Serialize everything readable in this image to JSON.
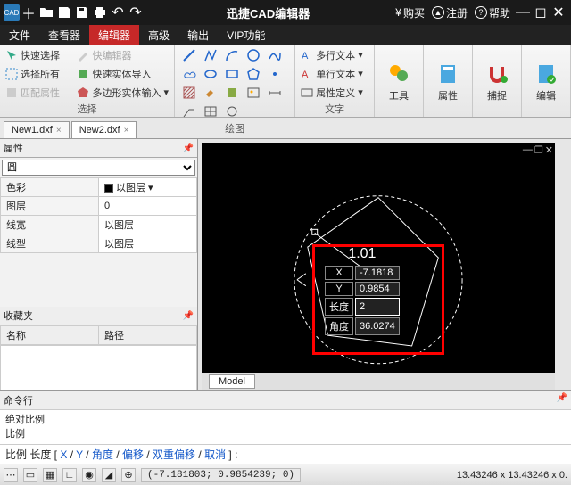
{
  "title": "迅捷CAD编辑器",
  "titlebar_right": {
    "buy": "购买",
    "register": "注册",
    "help": "帮助"
  },
  "menu": [
    "文件",
    "查看器",
    "编辑器",
    "高级",
    "输出",
    "VIP功能"
  ],
  "menu_active": 2,
  "ribbon": {
    "select": {
      "label": "选择",
      "quick": "快速选择",
      "all": "选择所有",
      "match": "匹配属性",
      "qedit": "快编辑器",
      "import": "快速实体导入",
      "poly": "多边形实体输入"
    },
    "draw": {
      "label": "绘图"
    },
    "text": {
      "label": "文字",
      "multi": "多行文本",
      "single": "单行文本",
      "attr": "属性定义"
    },
    "tools": "工具",
    "props": "属性",
    "capture": "捕捉",
    "edit": "编辑"
  },
  "file_tabs": [
    "New1.dxf",
    "New2.dxf"
  ],
  "file_tab_active": 1,
  "props_panel": {
    "title": "属性",
    "object": "圆",
    "rows": [
      {
        "k": "色彩",
        "v": "以图层",
        "swatch": true
      },
      {
        "k": "图层",
        "v": "0"
      },
      {
        "k": "线宽",
        "v": "以图层"
      },
      {
        "k": "线型",
        "v": "以图层"
      }
    ]
  },
  "fav": {
    "title": "收藏夹",
    "cols": [
      "名称",
      "路径"
    ]
  },
  "canvas": {
    "coord_title": "1.01",
    "fields": [
      {
        "k": "X",
        "v": "-7.1818"
      },
      {
        "k": "Y",
        "v": "0.9854"
      },
      {
        "k": "长度",
        "v": "2"
      },
      {
        "k": "角度",
        "v": "36.0274"
      }
    ],
    "active_field": 2,
    "model_tab": "Model"
  },
  "cmd": {
    "title": "命令行",
    "lines": [
      "绝对比例",
      "比例"
    ]
  },
  "prompt": {
    "prefix": "比例 长度",
    "opts": [
      "X",
      "Y",
      "角度",
      "偏移",
      "双重偏移",
      "取消"
    ]
  },
  "status": {
    "coords": "(-7.181803; 0.9854239; 0)",
    "zoom": "13.43246 x 13.43246 x 0."
  }
}
